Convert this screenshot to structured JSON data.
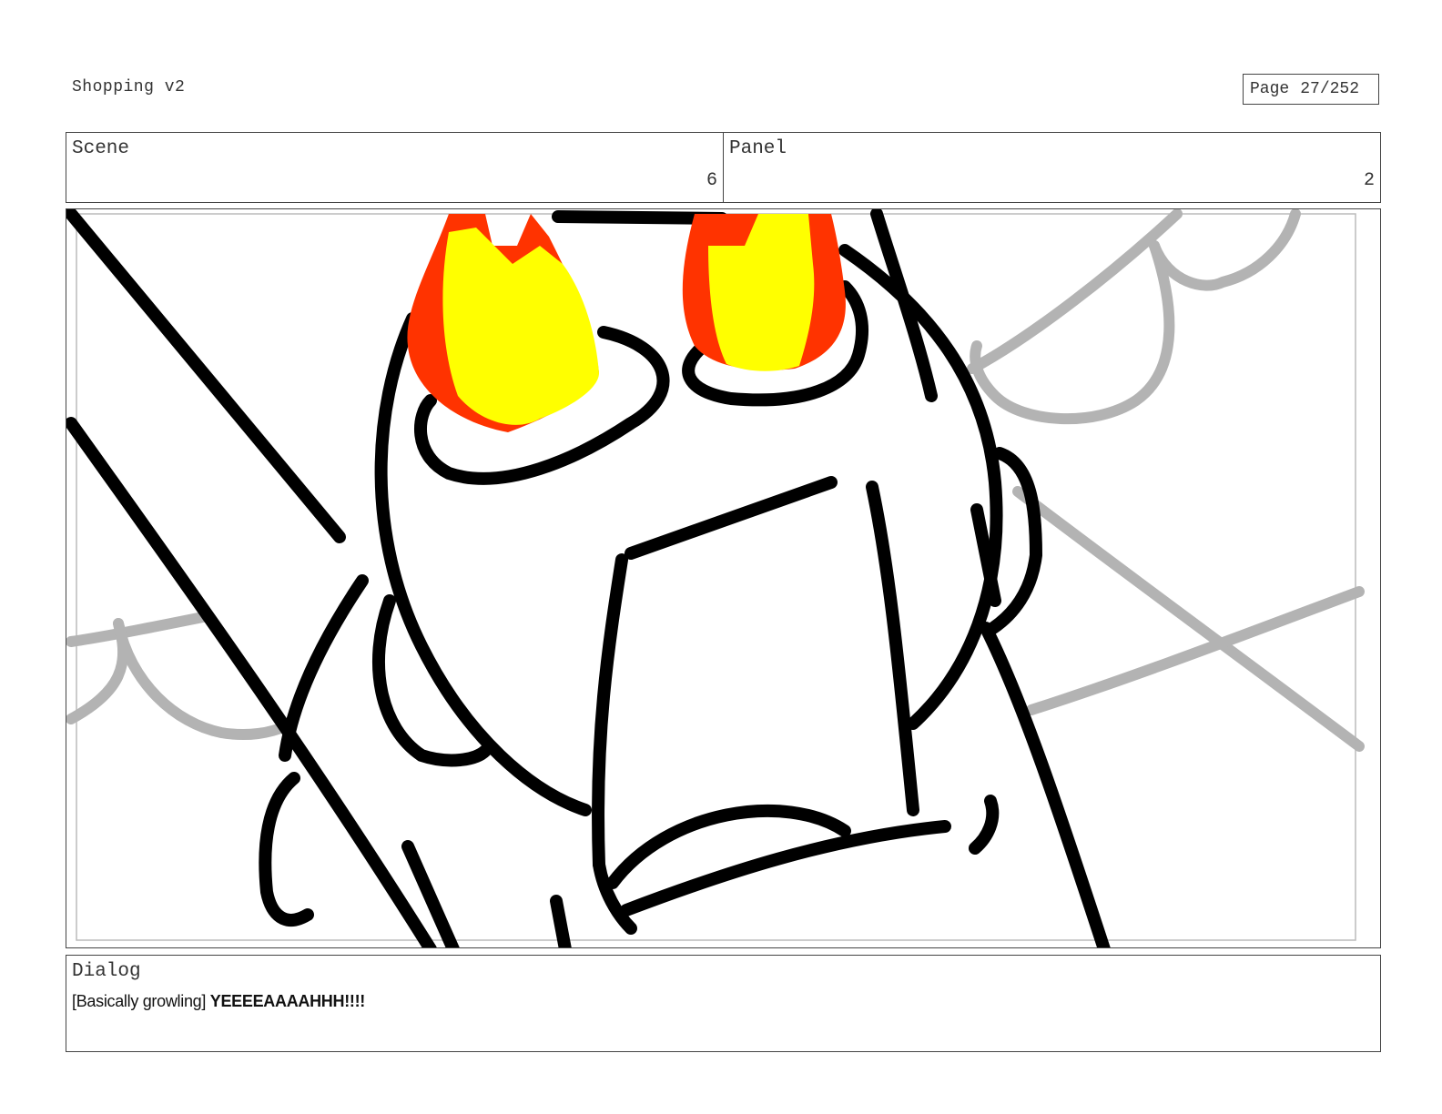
{
  "header": {
    "document_title": "Shopping v2",
    "page_label": "Page",
    "page_value": "27/252"
  },
  "info": {
    "scene_label": "Scene",
    "scene_value": "6",
    "panel_label": "Panel",
    "panel_value": "2"
  },
  "dialog": {
    "label": "Dialog",
    "direction": "[Basically growling]",
    "line": "YEEEEAAAAHHH!!!!"
  },
  "colors": {
    "ink": "#000000",
    "background_sketch": "#b3b3b3",
    "fire_outer": "#ff3300",
    "fire_inner": "#ffff00"
  }
}
